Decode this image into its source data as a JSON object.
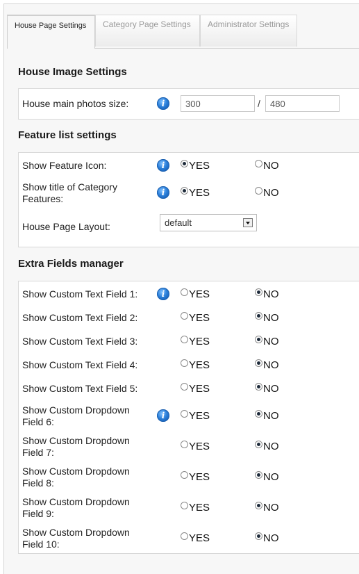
{
  "tabs": [
    {
      "label": "House Page Settings",
      "active": true
    },
    {
      "label": "Category Page Settings",
      "active": false
    },
    {
      "label": "Administrator Settings",
      "active": false
    }
  ],
  "image_section": {
    "title": "House Image Settings",
    "photo_size_label": "House main photos size:",
    "width_value": "300",
    "separator": "/",
    "height_value": "480"
  },
  "feature_section": {
    "title": "Feature list settings",
    "rows": [
      {
        "label": "Show Feature Icon:",
        "yes": "YES",
        "no": "NO",
        "selected": "YES"
      },
      {
        "label": "Show title of Category Features:",
        "yes": "YES",
        "no": "NO",
        "selected": "YES"
      }
    ],
    "layout_label": "House Page Layout:",
    "layout_value": "default"
  },
  "extra_section": {
    "title": "Extra Fields manager",
    "rows": [
      {
        "label": "Show Custom Text Field 1:",
        "yes": "YES",
        "no": "NO",
        "selected": "NO"
      },
      {
        "label": "Show Custom Text Field 2:",
        "yes": "YES",
        "no": "NO",
        "selected": "NO"
      },
      {
        "label": "Show Custom Text Field 3:",
        "yes": "YES",
        "no": "NO",
        "selected": "NO"
      },
      {
        "label": "Show Custom Text Field 4:",
        "yes": "YES",
        "no": "NO",
        "selected": "NO"
      },
      {
        "label": "Show Custom Text Field 5:",
        "yes": "YES",
        "no": "NO",
        "selected": "NO"
      },
      {
        "label": "Show Custom Dropdown Field 6:",
        "yes": "YES",
        "no": "NO",
        "selected": "NO"
      },
      {
        "label": "Show Custom Dropdown Field 7:",
        "yes": "YES",
        "no": "NO",
        "selected": "NO"
      },
      {
        "label": "Show Custom Dropdown Field 8:",
        "yes": "YES",
        "no": "NO",
        "selected": "NO"
      },
      {
        "label": "Show Custom Dropdown Field 9:",
        "yes": "YES",
        "no": "NO",
        "selected": "NO"
      },
      {
        "label": "Show Custom Dropdown Field 10:",
        "yes": "YES",
        "no": "NO",
        "selected": "NO"
      }
    ]
  },
  "icons": {
    "info": "info-icon"
  },
  "colors": {
    "info_blue": "#2a7ed8",
    "panel_bg": "#f7f7f7"
  }
}
